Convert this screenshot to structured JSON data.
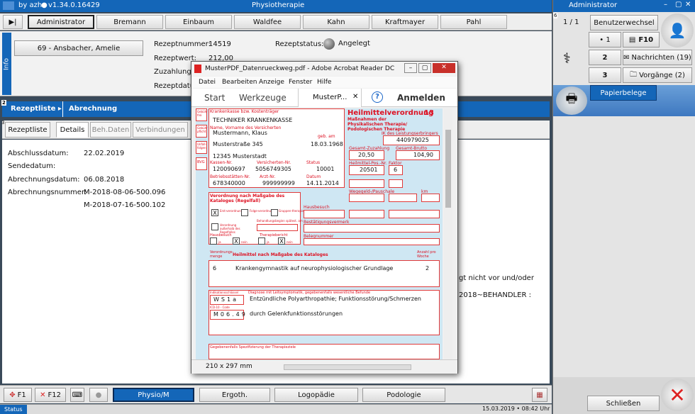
{
  "titlebar": {
    "logo": "by azh",
    "version": "v1.34.0.16429",
    "title": "Physiotherapie"
  },
  "users": [
    "Administrator",
    "Bremann",
    "Einbaum",
    "Waldfee",
    "Kahn",
    "Kraftmayer",
    "Pahl"
  ],
  "info": {
    "tab": "Info",
    "patient": "69 - Ansbacher, Amelie",
    "rezeptnummer_label": "Rezeptnummer:",
    "rezeptnummer": "14519",
    "rezeptwert_label": "Rezeptwert:",
    "rezeptwert": "212,00",
    "zuzahlung_label": "Zuzahlung:",
    "rezeptdatum_label": "Rezeptdatum",
    "status_label": "Rezeptstatus:",
    "status": "Angelegt"
  },
  "nav": {
    "rezeptliste": "Rezeptliste ▸",
    "abrechnung": "Abrechnung",
    "num": "2"
  },
  "subtabs": {
    "num": "3",
    "rezeptliste": "Rezeptliste",
    "details": "Details",
    "behdaten": "Beh.Daten",
    "verbindungen": "Verbindungen"
  },
  "details": {
    "abschluss_label": "Abschlussdatum:",
    "abschluss": "22.02.2019",
    "sende_label": "Sendedatum:",
    "abrechnungsdatum_label": "Abrechnungsdatum:",
    "abrechnungsdatum": "06.08.2018",
    "abrechnungsnummer_label": "Abrechnungsnummer:",
    "abrechnungsnummer1": "M-2018-08-06-500.096",
    "abrechnungsnummer2": "M-2018-07-16-500.102",
    "right_text1": "gt nicht vor und/oder",
    "right_text2": "2018~BEHANDLER :"
  },
  "bottom": {
    "f1": "F1",
    "f12": "F12",
    "physio": "Physio/M",
    "ergo": "Ergoth.",
    "logo": "Logopädie",
    "podo": "Podologie"
  },
  "status": {
    "label": "Status",
    "datetime": "15.03.2019 • 08:42 Uhr"
  },
  "right": {
    "title": "Administrator",
    "num": "6",
    "page": "1 / 1",
    "benutzerwechsel": "Benutzerwechsel",
    "row1_num": "• 1",
    "row1_label": "F10",
    "row2_num": "2",
    "row2_label": "Nachrichten (19)",
    "row3_num": "3",
    "row3_label": "Vorgänge (2)",
    "papierbelege": "Papierbelege",
    "schliessen": "Schließen"
  },
  "acrobat": {
    "title": "MusterPDF_Datenrueckweg.pdf - Adobe Acrobat Reader DC",
    "menu": [
      "Datei",
      "Bearbeiten",
      "Anzeige",
      "Fenster",
      "Hilfe"
    ],
    "tab_start": "Start",
    "tab_werkzeuge": "Werkzeuge",
    "tab_doc": "MusterP...",
    "help": "?",
    "anmelden": "Anmelden",
    "page_size": "210 x 297 mm"
  },
  "form": {
    "kasse_label": "Krankenkasse bzw. Kostenträger",
    "kasse": "TECHNIKER KRANKENKASSE",
    "name_label": "Name, Vorname des Versicherten",
    "geb_label": "geb. am",
    "name": "Mustermann, Klaus",
    "street": "Musterstraße 345",
    "dob": "18.03.1968",
    "city": "12345 Musterstadt",
    "kassennr_label": "Kassen-Nr.",
    "versnr_label": "Versicherten-Nr.",
    "status_label": "Status",
    "kassennr": "120090697",
    "versnr": "5056749305",
    "status": "10001",
    "betrieb_label": "Betriebsstätten-Nr.",
    "arzt_label": "Arzt-Nr.",
    "datum_label": "Datum",
    "betrieb": "678340000",
    "arzt": "999999999",
    "datum": "14.11.2014",
    "side1": "Gebühr frei",
    "side2": "Gebühr pflicht",
    "side3": "Unfall-folgen",
    "side4": "BVG",
    "hv_title": "Heilmittelverordnung",
    "hv_num": "13",
    "hv_sub1": "Maßnahmen der",
    "hv_sub2": "Physikalischen Therapie/",
    "hv_sub3": "Podologischen Therapie",
    "ik_label": "IK des Leistungserbringers",
    "ik": "440979025",
    "gesamt_label": "Gesamt-Zuzahlung",
    "gesamt": "20,50",
    "brutto_label": "Gesamt-Brutto",
    "brutto": "104,90",
    "pos_label": "Heilmittel-Pos.-Nr.",
    "faktor_label": "Faktor",
    "pos": "20501",
    "faktor": "6",
    "wegegeld_label": "Wegegeld-/Pauschale",
    "km_label": "km",
    "haus_label": "Hausbesuch",
    "vo_title": "Verordnung nach Maßgabe des Kataloges (Regelfall)",
    "erst_label": "Erst-verordnung",
    "folge_label": "Folge-verordnung",
    "gruppe_label": "Gruppen-therapie",
    "ausser_label": "Verordnung außerhalb des Regelfalles",
    "beginn_label": "Behandlungsbeginn spätest. am",
    "hausbesuch_label": "Hausbesuch",
    "ja": "ja",
    "nein": "nein",
    "bericht_label": "Therapiebericht",
    "bestaetigung_label": "Bestätigungsvermerk",
    "belegnr_label": "Belegnummer",
    "menge_label": "Verordnungs-menge",
    "heilmittel_title": "Heilmittel nach Maßgabe des Kataloges",
    "anzahl_label": "Anzahl pro Woche",
    "menge": "6",
    "heilmittel": "Krankengymnastik auf neurophysiologischer Grundlage",
    "anzahl": "2",
    "indik_label": "Indikationsschlüssel",
    "icd_label": "ICD-10 - Code",
    "diag_label": "Diagnose mit Leitsymptomatik, gegebenenfalls wesentliche Befunde",
    "indik": "WS1a",
    "icd": "M06.49",
    "diag1": "Entzündliche Polyarthropathie; Funktionsstörung/Schmerzen",
    "diag2": "durch Gelenkfunktionsstörungen",
    "ziele_label": "Gegebenenfalls Spezifizierung der Therapieziele"
  }
}
